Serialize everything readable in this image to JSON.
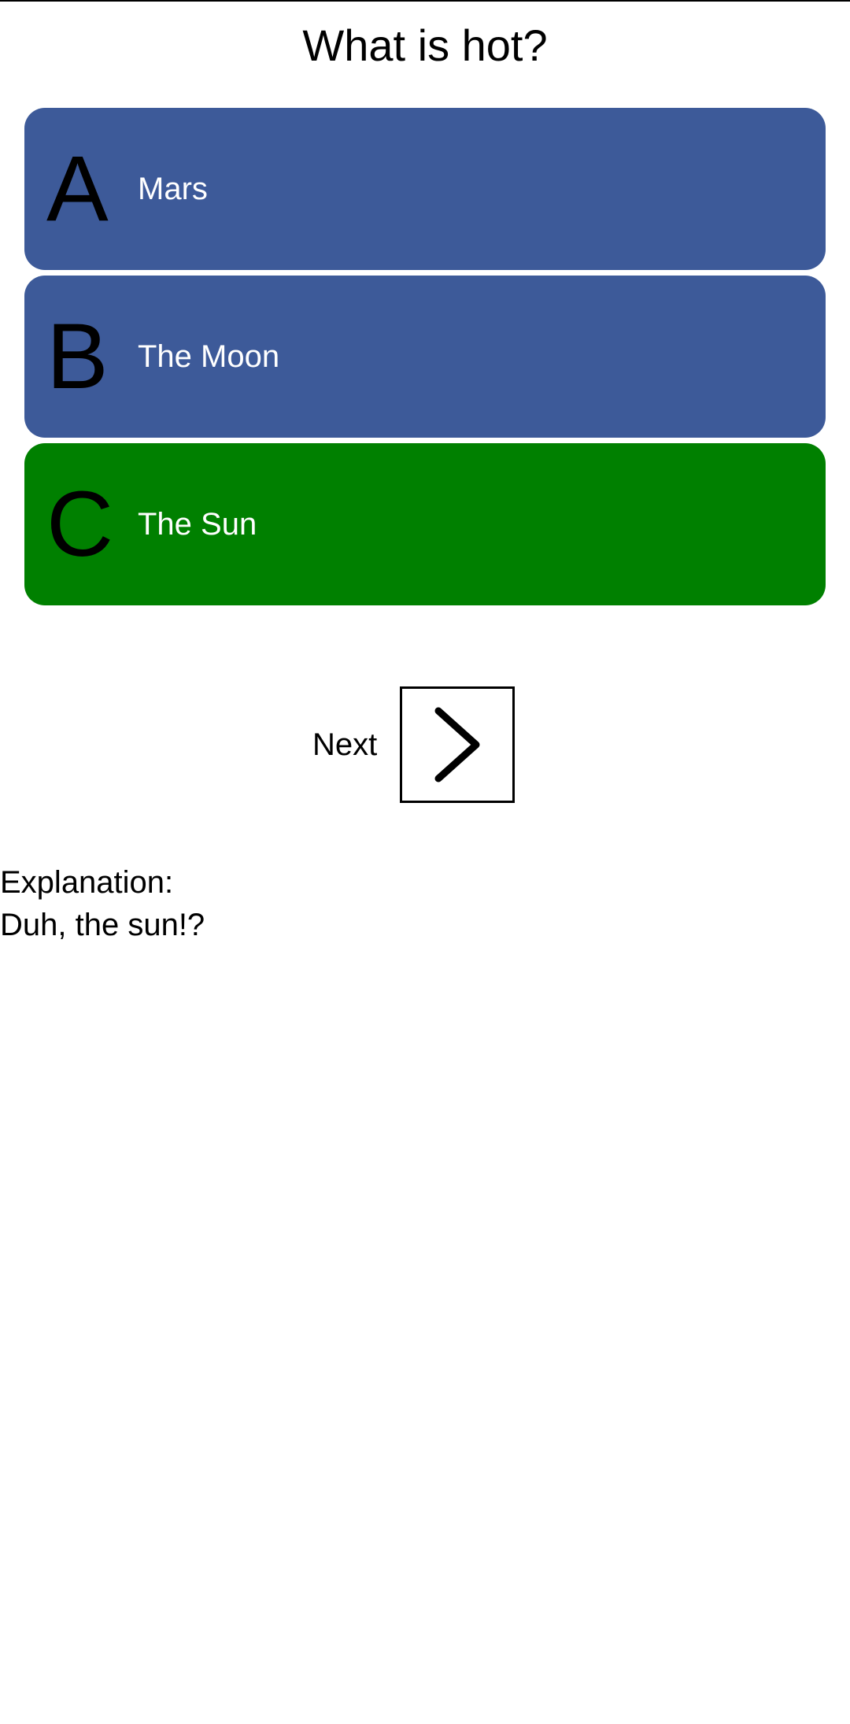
{
  "question": {
    "text": "What is hot?"
  },
  "answers": [
    {
      "letter": "A",
      "text": "Mars",
      "color": "#3d5a99"
    },
    {
      "letter": "B",
      "text": "The Moon",
      "color": "#3d5a99"
    },
    {
      "letter": "C",
      "text": "The Sun",
      "color": "#008000"
    }
  ],
  "next": {
    "label": "Next",
    "icon": "chevron-right-icon"
  },
  "explanation": {
    "heading": "Explanation:",
    "text": "Duh, the sun!?"
  }
}
